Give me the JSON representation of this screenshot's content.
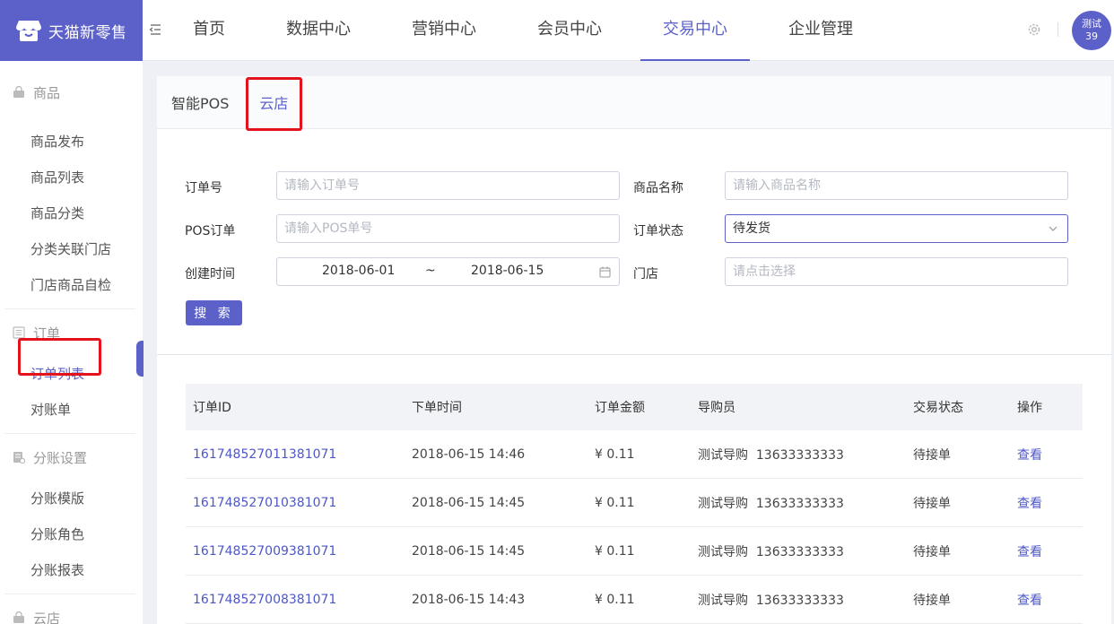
{
  "app": {
    "title": "天猫新零售"
  },
  "nav": {
    "items": [
      {
        "label": "首页",
        "active": false
      },
      {
        "label": "数据中心",
        "active": false
      },
      {
        "label": "营销中心",
        "active": false
      },
      {
        "label": "会员中心",
        "active": false
      },
      {
        "label": "交易中心",
        "active": true
      },
      {
        "label": "企业管理",
        "active": false
      }
    ]
  },
  "user": {
    "line1": "测试",
    "line2": "39"
  },
  "sidebar": {
    "groups": [
      {
        "label": "商品",
        "icon": "bag-icon",
        "items": [
          "商品发布",
          "商品列表",
          "商品分类",
          "分类关联门店",
          "门店商品自检"
        ]
      },
      {
        "label": "订单",
        "icon": "list-icon",
        "items": [
          "订单列表",
          "对账单"
        ]
      },
      {
        "label": "分账设置",
        "icon": "ledger-icon",
        "items": [
          "分账模版",
          "分账角色",
          "分账报表"
        ]
      },
      {
        "label": "云店",
        "icon": "bag-icon",
        "items": []
      }
    ],
    "active_item": "订单列表"
  },
  "tabs": [
    {
      "label": "智能POS",
      "active": false
    },
    {
      "label": "云店",
      "active": true
    }
  ],
  "form": {
    "order_no": {
      "label": "订单号",
      "placeholder": "请输入订单号",
      "value": ""
    },
    "product_name": {
      "label": "商品名称",
      "placeholder": "请输入商品名称",
      "value": ""
    },
    "pos_order": {
      "label": "POS订单",
      "placeholder": "请输入POS单号",
      "value": ""
    },
    "order_status": {
      "label": "订单状态",
      "value": "待发货"
    },
    "created_time": {
      "label": "创建时间",
      "start": "2018-06-01",
      "separator": "~",
      "end": "2018-06-15"
    },
    "store": {
      "label": "门店",
      "placeholder": "请点击选择",
      "value": ""
    },
    "search_label": "搜 索"
  },
  "table": {
    "columns": [
      "订单ID",
      "下单时间",
      "订单金额",
      "导购员",
      "交易状态",
      "操作"
    ],
    "rows": [
      {
        "id": "161748527011381071",
        "time": "2018-06-15 14:46",
        "amount": "¥ 0.11",
        "guide": "测试导购  13633333333",
        "status": "待接单",
        "action": "查看"
      },
      {
        "id": "161748527010381071",
        "time": "2018-06-15 14:45",
        "amount": "¥ 0.11",
        "guide": "测试导购  13633333333",
        "status": "待接单",
        "action": "查看"
      },
      {
        "id": "161748527009381071",
        "time": "2018-06-15 14:45",
        "amount": "¥ 0.11",
        "guide": "测试导购  13633333333",
        "status": "待接单",
        "action": "查看"
      },
      {
        "id": "161748527008381071",
        "time": "2018-06-15 14:43",
        "amount": "¥ 0.11",
        "guide": "测试导购  13633333333",
        "status": "待接单",
        "action": "查看"
      }
    ]
  },
  "colors": {
    "accent": "#5c61c9",
    "highlight": "#e3121b",
    "link": "#4d57c8"
  }
}
